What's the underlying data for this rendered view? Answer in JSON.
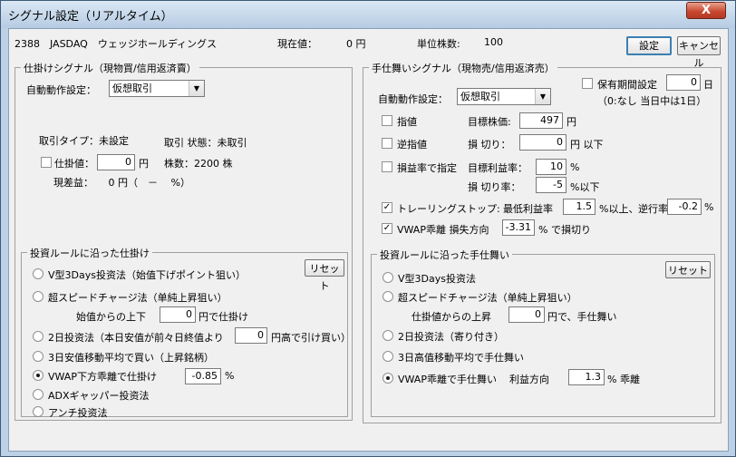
{
  "window": {
    "title": "シグナル設定（リアルタイム）",
    "close_glyph": "X"
  },
  "header": {
    "stock": "2388　JASDAQ　ウェッジホールディングス",
    "price_label": "現在値：",
    "price_value": "0 円",
    "unit_label": "単位株数:",
    "unit_value": "100",
    "settings_button": "設定",
    "cancel_button": "キャンセル"
  },
  "left": {
    "group_title": "仕掛けシグナル（現物買/信用返済賣）",
    "auto_label": "自動動作設定：",
    "auto_value": "仮想取引",
    "trade_type": "取引タイプ：未設定",
    "trade_state": "取引 状態：未取引",
    "entry_price_label": "仕掛値：",
    "entry_price_value": "0",
    "entry_price_unit": "円",
    "shares": "株数：2200 株",
    "pnl": "現差益：　　0 円（　－　 %）",
    "rules_title": "投資ルールに沿った仕掛け",
    "reset": "リセット",
    "rules": [
      {
        "label": "V型3Days投资法（始值下げポイント狙い）",
        "checked": false
      },
      {
        "label": "超スピードチャージ法（单純上昇狙い）",
        "checked": false
      },
      {
        "label": "2日投资法（本日安值が前々日終值より",
        "checked": false
      },
      {
        "label": "3日安值移動平均で買い（上昇銘柄）",
        "checked": false
      },
      {
        "label": "VWAP下方乖離で仕掛け",
        "checked": true
      },
      {
        "label": "ADXギャッパー投资法",
        "checked": false
      },
      {
        "label": "アンチ投资法",
        "checked": false
      }
    ],
    "speed_sub_prefix": "始值からの上下",
    "speed_sub_value": "0",
    "speed_sub_suffix": "円で仕掛け",
    "twoday_value": "0",
    "twoday_suffix": "円高で引け買い）",
    "vwap_value": "-0.85",
    "vwap_unit": "%"
  },
  "right": {
    "group_title": "手仕舞いシグナル（現物売/信用返済売）",
    "auto_label": "自動動作設定：",
    "auto_value": "仮想取引",
    "hold_label": "保有期間設定",
    "hold_value": "0",
    "hold_unit": "日",
    "hold_note": "（0:なし 当日中は1日）",
    "limit_label": "指値",
    "target_price_label": "目標株価:",
    "target_price_value": "497",
    "target_price_unit": "円",
    "stop_label": "逆指値",
    "stoploss_label": "損 切り：",
    "stoploss_value": "0",
    "stoploss_unit": "円 以下",
    "pnl_rate_label": "損益率で指定",
    "target_rate_label": "目標利益率：",
    "target_rate_value": "10",
    "target_rate_unit": "%",
    "loss_rate_label": "損 切り率：",
    "loss_rate_value": "-5",
    "loss_rate_unit": "%以下",
    "trailing_label": "トレーリングストップ:",
    "min_profit_label": "最低利益率",
    "min_profit_value": "1.5",
    "min_profit_unit": "%以上、",
    "reverse_label": "逆行率",
    "reverse_value": "-0.2",
    "reverse_unit": "%",
    "vwap_label": "VWAP乖離 損失方向",
    "vwap_value": "-3.31",
    "vwap_unit": "% で損切り",
    "rules_title": "投資ルールに沿った手仕舞い",
    "reset": "リセット",
    "rules": [
      {
        "label": "V型3Days投资法",
        "checked": false
      },
      {
        "label": "超スピードチャージ法（单純上昇狙い）",
        "checked": false
      },
      {
        "label": "2日投资法（寄り付き）",
        "checked": false
      },
      {
        "label": "3日高值移動平均で手仕舞い",
        "checked": false
      },
      {
        "label": "VWAP乖離で手仕舞い",
        "checked": true
      }
    ],
    "speed_sub_prefix": "仕掛値からの上昇",
    "speed_sub_value": "0",
    "speed_sub_suffix": "円で、手仕舞い",
    "vwap_profit_label": "利益方向",
    "vwap_profit_value": "1.3",
    "vwap_profit_unit": "% 乖離"
  }
}
